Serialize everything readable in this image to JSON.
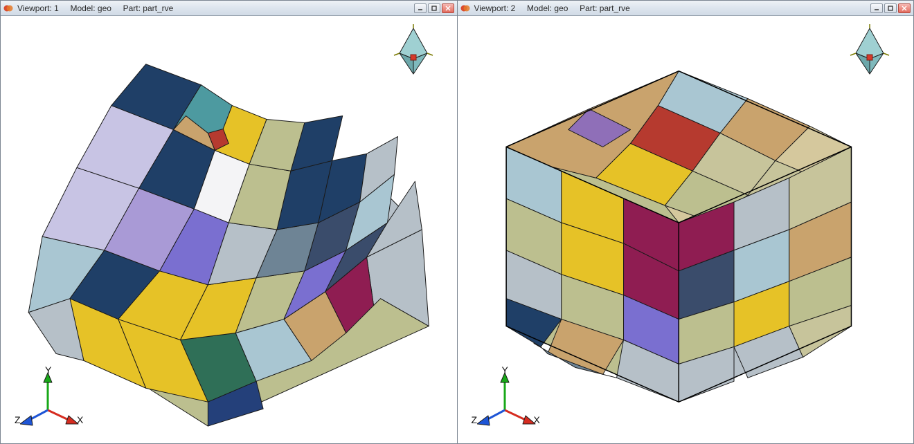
{
  "viewports": [
    {
      "titlebar": {
        "vp_label": "Viewport:",
        "vp_num": "1",
        "model_label": "Model:",
        "model_val": "geo",
        "part_label": "Part:",
        "part_val": "part_rve"
      },
      "axes": {
        "x": "X",
        "y": "Y",
        "z": "Z"
      }
    },
    {
      "titlebar": {
        "vp_label": "Viewport:",
        "vp_num": "2",
        "model_label": "Model:",
        "model_val": "geo",
        "part_label": "Part:",
        "part_val": "part_rve"
      },
      "axes": {
        "x": "X",
        "y": "Y",
        "z": "Z"
      }
    }
  ],
  "colors": {
    "yellow": "#e6c227",
    "darkblue": "#1f3f67",
    "olive": "#bcbf8f",
    "teal": "#4d9aa0",
    "purple": "#7a6fd0",
    "lilac": "#a99ad6",
    "magenta": "#8f1d52",
    "tan": "#c9a36d",
    "grey": "#b6c0c8",
    "lightblue": "#a9c6d2",
    "green": "#2f6f57",
    "red": "#b63a2f",
    "lavender": "#c8c4e4",
    "sand": "#d5c89d",
    "steel": "#6e8495",
    "white": "#f4f4f6",
    "slate": "#3a4c6b",
    "mauve": "#b48aa7",
    "khaki": "#c7c49b"
  },
  "icons": {
    "app": "app-icon",
    "minimize": "minimize-icon",
    "maximize": "maximize-icon",
    "close": "close-icon"
  }
}
